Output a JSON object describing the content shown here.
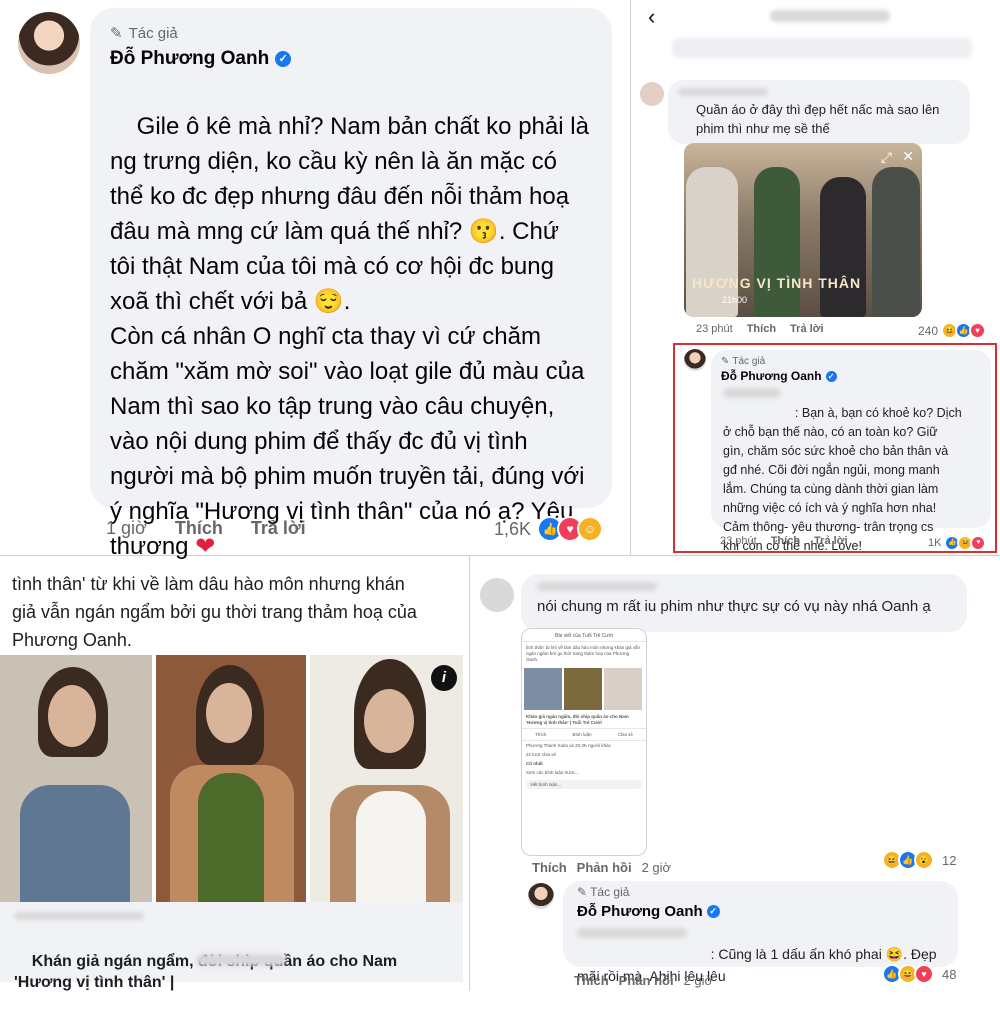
{
  "panel1": {
    "author_tag": "Tác giả",
    "author_name": "Đỗ Phương Oanh",
    "comment": "Gile ô kê mà nhỉ? Nam bản chất ko phải là\nng trưng diện, ko cầu kỳ nên là ăn mặc có\nthể ko đc đẹp nhưng đâu đến nỗi thảm hoạ\nđâu mà mng cứ làm quá thế nhỉ? 😗. Chứ\ntôi thật Nam của tôi mà có cơ hội đc bung\nxoã thì chết với bả 😌.\nCòn cá nhân O nghĩ cta thay vì cứ chăm\nchăm \"xăm mờ soi\" vào loạt gile đủ màu của\nNam thì sao ko tập trung vào câu chuyện,\nvào nội dung phim để thấy đc đủ vị tình\nngười mà bộ phim muốn truyền tải, đúng với\ný nghĩa \"Hương vị tình thân\" của nó ạ? Yêu\nthương",
    "time": "1 giờ",
    "like": "Thích",
    "reply": "Trả lời",
    "reaction_count": "1,6K"
  },
  "panel2": {
    "comment": "Quần áo ở đây thì đẹp hết nấc mà sao lên\nphim thì như mẹ sề thế",
    "poster_title": "HƯƠNG VỊ TÌNH THÂN",
    "poster_time": "21h00",
    "meta_time": "23 phút",
    "meta_like": "Thích",
    "meta_reply": "Trả lời",
    "reaction_count": "240",
    "author_tag": "Tác giả",
    "author_name": "Đỗ Phương Oanh",
    "reply": ": Bạn à, bạn có khoẻ ko? Dịch\nở chỗ bạn thế nào, có an toàn ko? Giữ\ngìn, chăm sóc sức khoẻ cho bản thân và\ngđ nhé. Cõi đời ngắn ngủi, mong manh\nlắm. Chúng ta cùng dành thời gian làm\nnhững việc có ích và ý nghĩa hơn nha!\nCảm thông- yêu thương- trân trọng cs\nkhi còn có thể nhé. Love!",
    "reply_time": "23 phút",
    "reply_like": "Thích",
    "reply_reply": "Trả lời",
    "reply_reaction_count": "1K"
  },
  "panel3": {
    "headline": "tình thân' từ khi về làm dâu hào môn nhưng khán\ngiả vẫn ngán ngẩm bởi gu thời trang thảm hoạ của\nPhương Oanh.",
    "info_badge": "i",
    "caption_title": "Khán giả ngán ngẩm, đòi ship quần áo cho Nam\n'Hương vị tình thân' |"
  },
  "panel4": {
    "comment": "nói chung m rất iu phim như thực sự có vụ này nhá Oanh ạ",
    "phone_header": "Bài viết của Tuổi Trẻ Cười",
    "phone_body": "tình thân' từ khi về làm dâu hào môn nhưng khán giả vẫn ngán ngẩm bởi gu thời trang thảm hoạ của Phương Oanh.",
    "phone_caption": "Khán giả ngán ngẩm, đòi ship quần áo cho Nam 'Hương vị tình thân' | Tuổi Trẻ Cười",
    "phone_like": "Thích",
    "phone_comment": "Bình luận",
    "phone_share": "Chia sẻ",
    "phone_reactions": "Phương Thanh Xuka và 20,3K người khác",
    "phone_shares": "22 lượt chia sẻ",
    "phone_top": "Cũ nhất",
    "phone_more": "Xem các bình luận trước...",
    "phone_input": "Viết bình luận...",
    "meta_like": "Thích",
    "meta_reply": "Phản hồi",
    "meta_time": "2 giờ",
    "reaction_count": "12",
    "author_tag": "Tác giả",
    "author_name": "Đỗ Phương Oanh",
    "reply": ": Cũng là 1 dấu ấn khó phai 😆. Đẹp\nmãi rồi mà. Ahihi lêu lêu",
    "reply_like": "Thích",
    "reply_reply": "Phản hồi",
    "reply_time": "2 giờ",
    "reply_reaction_count": "48"
  }
}
